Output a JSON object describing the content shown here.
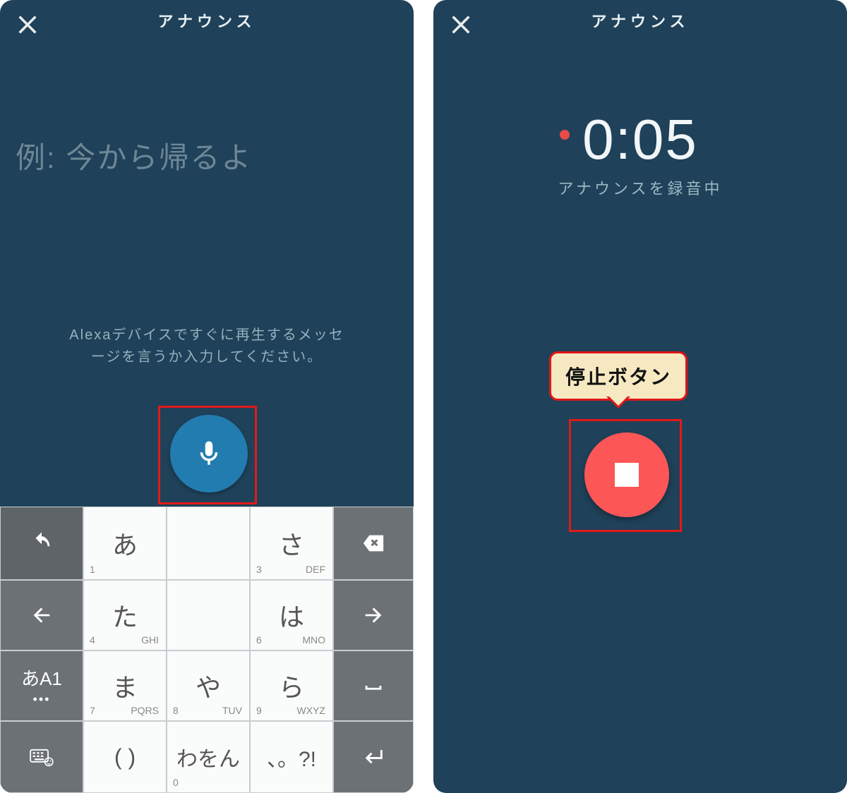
{
  "left": {
    "title": "アナウンス",
    "placeholder": "例: 今から帰るよ",
    "instructions": "Alexaデバイスですぐに再生するメッセージを言うか入力してください。",
    "mic_highlight": true
  },
  "right": {
    "title": "アナウンス",
    "timer": "0:05",
    "status": "アナウンスを録音中",
    "callout": "停止ボタン"
  },
  "keyboard": {
    "rows": [
      [
        {
          "type": "dark",
          "icon": "undo"
        },
        {
          "main": "あ",
          "subL": "1"
        },
        {
          "main": "",
          "hidden": true
        },
        {
          "main": "さ",
          "subL": "3",
          "subR": "DEF"
        },
        {
          "type": "dark2",
          "icon": "backspace"
        }
      ],
      [
        {
          "type": "dark2",
          "icon": "arrow-left"
        },
        {
          "main": "た",
          "subL": "4",
          "subR": "GHI"
        },
        {
          "main": "",
          "hidden": true
        },
        {
          "main": "は",
          "subL": "6",
          "subR": "MNO"
        },
        {
          "type": "dark2",
          "icon": "arrow-right"
        }
      ],
      [
        {
          "type": "dark2",
          "mode": "あA1"
        },
        {
          "main": "ま",
          "subL": "7",
          "subR": "PQRS"
        },
        {
          "main": "や",
          "subL": "8",
          "subR": "TUV"
        },
        {
          "main": "ら",
          "subL": "9",
          "subR": "WXYZ"
        },
        {
          "type": "dark2",
          "icon": "space"
        }
      ],
      [
        {
          "type": "dark2",
          "icon": "kb-emoji"
        },
        {
          "main": "( )"
        },
        {
          "main": "わをん",
          "subL": "0"
        },
        {
          "main": "、。?!"
        },
        {
          "type": "dark2",
          "icon": "enter"
        }
      ]
    ]
  }
}
